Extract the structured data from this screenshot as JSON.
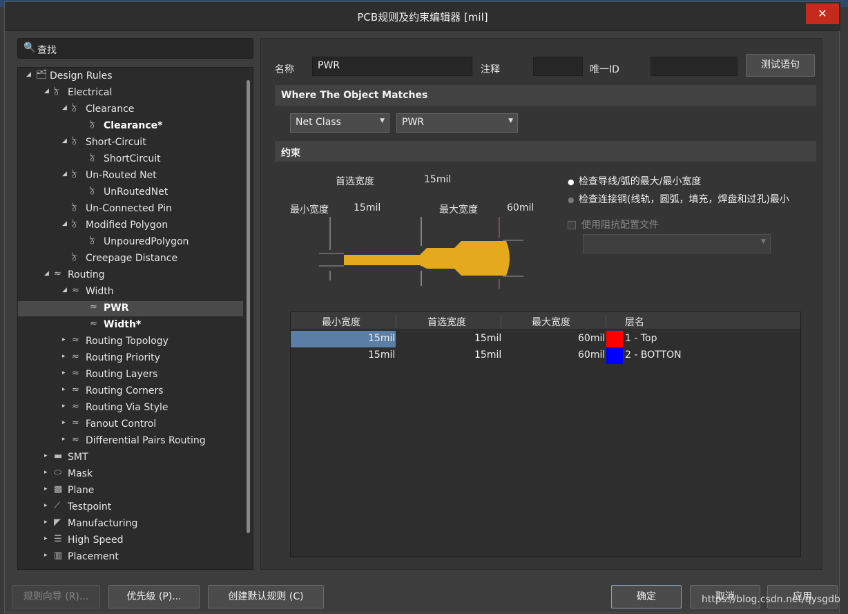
{
  "window": {
    "title": "PCB规则及约束编辑器 [mil]",
    "close_glyph": "✕"
  },
  "search": {
    "label": "查找",
    "icon": "search-icon"
  },
  "tree": [
    {
      "label": "Design Rules",
      "arrow": "◢",
      "icon": "🗂",
      "bold": false
    },
    {
      "label": "Electrical",
      "arrow": "◢",
      "icon": "ঠ",
      "bold": false
    },
    {
      "label": "Clearance",
      "arrow": "◢",
      "icon": "ঠ",
      "bold": false
    },
    {
      "label": "Clearance*",
      "arrow": "",
      "icon": "ঠ",
      "bold": true
    },
    {
      "label": "Short-Circuit",
      "arrow": "◢",
      "icon": "ঠ",
      "bold": false
    },
    {
      "label": "ShortCircuit",
      "arrow": "",
      "icon": "ঠ",
      "bold": false
    },
    {
      "label": "Un-Routed Net",
      "arrow": "◢",
      "icon": "ঠ",
      "bold": false
    },
    {
      "label": "UnRoutedNet",
      "arrow": "",
      "icon": "ঠ",
      "bold": false
    },
    {
      "label": "Un-Connected Pin",
      "arrow": "",
      "icon": "ঠ",
      "bold": false
    },
    {
      "label": "Modified Polygon",
      "arrow": "◢",
      "icon": "ঠ",
      "bold": false
    },
    {
      "label": "UnpouredPolygon",
      "arrow": "",
      "icon": "ঠ",
      "bold": false
    },
    {
      "label": "Creepage Distance",
      "arrow": "",
      "icon": "ঠ",
      "bold": false
    },
    {
      "label": "Routing",
      "arrow": "◢",
      "icon": "≈",
      "bold": false
    },
    {
      "label": "Width",
      "arrow": "◢",
      "icon": "≈",
      "bold": false
    },
    {
      "label": "PWR",
      "arrow": "",
      "icon": "≈",
      "bold": true
    },
    {
      "label": "Width*",
      "arrow": "",
      "icon": "≈",
      "bold": true
    },
    {
      "label": "Routing Topology",
      "arrow": "▸",
      "icon": "≈",
      "bold": false
    },
    {
      "label": "Routing Priority",
      "arrow": "▸",
      "icon": "≈",
      "bold": false
    },
    {
      "label": "Routing Layers",
      "arrow": "▸",
      "icon": "≈",
      "bold": false
    },
    {
      "label": "Routing Corners",
      "arrow": "▸",
      "icon": "≈",
      "bold": false
    },
    {
      "label": "Routing Via Style",
      "arrow": "▸",
      "icon": "≈",
      "bold": false
    },
    {
      "label": "Fanout Control",
      "arrow": "▸",
      "icon": "≈",
      "bold": false
    },
    {
      "label": "Differential Pairs Routing",
      "arrow": "▸",
      "icon": "≈",
      "bold": false
    },
    {
      "label": "SMT",
      "arrow": "▸",
      "icon": "▬",
      "bold": false
    },
    {
      "label": "Mask",
      "arrow": "▸",
      "icon": "⬭",
      "bold": false
    },
    {
      "label": "Plane",
      "arrow": "▸",
      "icon": "▩",
      "bold": false
    },
    {
      "label": "Testpoint",
      "arrow": "▸",
      "icon": "⟋",
      "bold": false
    },
    {
      "label": "Manufacturing",
      "arrow": "▸",
      "icon": "◤",
      "bold": false
    },
    {
      "label": "High Speed",
      "arrow": "▸",
      "icon": "☰",
      "bold": false
    },
    {
      "label": "Placement",
      "arrow": "▸",
      "icon": "▥",
      "bold": false
    }
  ],
  "form": {
    "name_label": "名称",
    "name_value": "PWR",
    "comment_label": "注释",
    "comment_value": "",
    "uid_label": "唯一ID",
    "uid_value": "",
    "test_button": "测试语句"
  },
  "match": {
    "header": "Where The Object Matches",
    "type": "Net Class",
    "value": "PWR"
  },
  "constraints": {
    "header": "约束",
    "preferred_label": "首选宽度",
    "preferred_value": "15mil",
    "min_label": "最小宽度",
    "min_value": "15mil",
    "max_label": "最大宽度",
    "max_value": "60mil",
    "radio1": "检查导线/弧的最大/最小宽度",
    "radio2": "检查连接铜(线轨，圆弧，填充，焊盘和过孔)最小",
    "radio1_glyph": "●",
    "radio2_glyph": "●",
    "checkbox": "使用阻抗配置文件",
    "diagram_color": "#e5a91d"
  },
  "grid": {
    "columns": [
      "最小宽度",
      "首选宽度",
      "最大宽度",
      "层名"
    ],
    "rows": [
      {
        "min": "15mil",
        "pref": "15mil",
        "max": "60mil",
        "color": "#ff0000",
        "layer": "1 - Top"
      },
      {
        "min": "15mil",
        "pref": "15mil",
        "max": "60mil",
        "color": "#0000ff",
        "layer": "2 - BOTTON"
      }
    ]
  },
  "footer": {
    "wizard": "规则向导 (R)...",
    "priority": "优先级 (P)...",
    "create_default": "创建默认规则 (C)",
    "ok": "确定",
    "cancel": "取消",
    "apply": "应用"
  },
  "watermark": "https://blog.csdn.net/qysgdb"
}
